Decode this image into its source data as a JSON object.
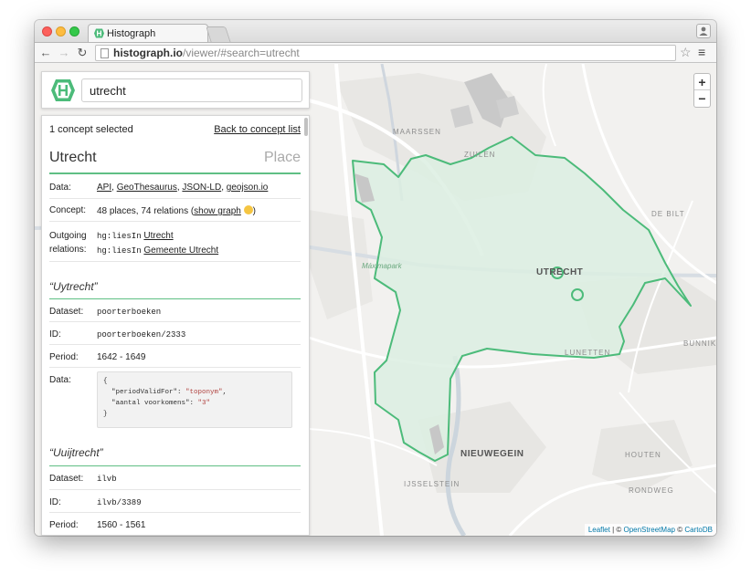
{
  "browser": {
    "tab_title": "Histograph",
    "url_host": "histograph.io",
    "url_path": "/viewer/#search=utrecht",
    "profile_icon": "person-icon",
    "back_icon": "back-arrow-icon",
    "forward_icon": "forward-arrow-icon",
    "reload_icon": "reload-icon",
    "star_icon": "star-icon",
    "menu_icon": "hamburger-menu-icon"
  },
  "search": {
    "value": "utrecht"
  },
  "panel": {
    "selected_text": "1 concept selected",
    "back_link": "Back to concept list",
    "concept_name": "Utrecht",
    "concept_type": "Place",
    "data_label": "Data:",
    "data_links": [
      "API",
      "GeoThesaurus",
      "JSON-LD",
      "geojson.io"
    ],
    "concept_label": "Concept:",
    "concept_text": "48 places, 74 relations (",
    "show_graph_link": "show graph",
    "concept_close": ")",
    "outgoing_label_1": "Outgoing",
    "outgoing_label_2": "relations:",
    "relations": [
      {
        "predicate": "hg:liesIn",
        "target": "Utrecht"
      },
      {
        "predicate": "hg:liesIn",
        "target": "Gemeente Utrecht"
      }
    ],
    "names": [
      {
        "title": "“Uytrecht”",
        "dataset_label": "Dataset:",
        "dataset": "poorterboeken",
        "id_label": "ID:",
        "id": "poorterboeken/2333",
        "period_label": "Period:",
        "period": "1642 - 1649",
        "data_label": "Data:",
        "code_open": "{",
        "code_key1": "\"periodValidFor\"",
        "code_val1": "\"toponym\"",
        "code_key2": "\"aantal voorkomens\"",
        "code_val2": "\"3\"",
        "code_close": "}"
      },
      {
        "title": "“Uuijtrecht”",
        "dataset_label": "Dataset:",
        "dataset": "ilvb",
        "id_label": "ID:",
        "id": "ilvb/3389",
        "period_label": "Period:",
        "period": "1560 - 1561"
      }
    ]
  },
  "map": {
    "zoom_in": "+",
    "zoom_out": "−",
    "attribution_leaflet": "Leaflet",
    "attribution_sep1": " | © ",
    "attribution_osm": "OpenStreetMap",
    "attribution_sep2": " © ",
    "attribution_carto": "CartoDB",
    "labels": {
      "maarssen": "MAARSSEN",
      "zuilen": "ZUILEN",
      "de_bilt": "DE BILT",
      "maximapark": "Máximapark",
      "utrecht": "UTRECHT",
      "lunetten": "LUNETTEN",
      "bunnik": "BUNNIK",
      "nieuwegein": "NIEUWEGEIN",
      "houten": "HOUTEN",
      "ijsselstein": "IJSSELSTEIN",
      "rondweg": "RONDWEG"
    },
    "boundary_color": "#4cbb7a",
    "fill_color": "#dcefe2"
  }
}
